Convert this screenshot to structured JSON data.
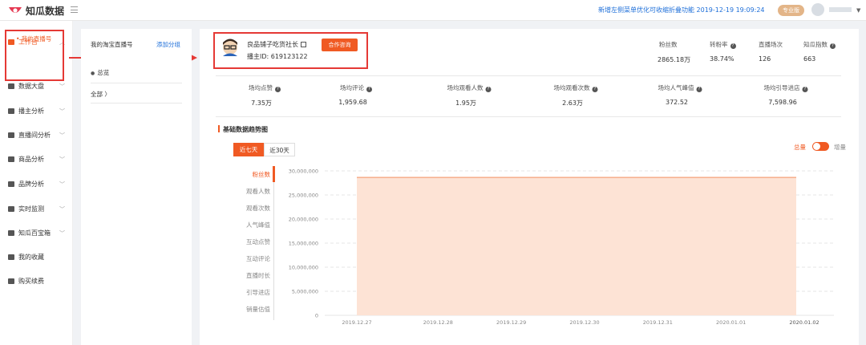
{
  "app": {
    "name": "知瓜数据"
  },
  "header": {
    "notice": "新增左侧菜单优化可收缩折叠功能  2019-12-19 19:09:24",
    "badge": "专业版"
  },
  "sidebar": {
    "items": [
      {
        "label": "工作台",
        "icon": "workspace-icon",
        "active": true
      },
      {
        "label": "数据大盘",
        "icon": "dashboard-icon"
      },
      {
        "label": "播主分析",
        "icon": "anchor-analysis-icon"
      },
      {
        "label": "直播间分析",
        "icon": "live-room-icon"
      },
      {
        "label": "商品分析",
        "icon": "product-icon"
      },
      {
        "label": "品牌分析",
        "icon": "brand-icon"
      },
      {
        "label": "实时监测",
        "icon": "monitor-icon"
      },
      {
        "label": "知瓜百宝箱",
        "icon": "toolbox-icon"
      },
      {
        "label": "我的收藏",
        "icon": "bookmark-icon"
      },
      {
        "label": "购买续费",
        "icon": "cart-icon"
      }
    ],
    "sub_item": "• 我的直播号"
  },
  "panel": {
    "title": "我的淘宝直播号",
    "add_group": "添加分组",
    "overview": "总览",
    "all": "全部  〉"
  },
  "anchor": {
    "name": "良品铺子吃货社长",
    "id": "播主ID: 619123122",
    "consult_button": "合作咨询"
  },
  "header_stats": [
    {
      "label": "粉丝数",
      "value": "2865.18万",
      "help": false
    },
    {
      "label": "转粉率",
      "value": "38.74%",
      "help": true
    },
    {
      "label": "直播场次",
      "value": "126",
      "help": false
    },
    {
      "label": "知瓜指数",
      "value": "663",
      "help": true
    }
  ],
  "stats": [
    {
      "label": "场均点赞",
      "value": "7.35万"
    },
    {
      "label": "场均评论",
      "value": "1,959.68"
    },
    {
      "label": "场均观看人数",
      "value": "1.95万"
    },
    {
      "label": "场均观看次数",
      "value": "2.63万"
    },
    {
      "label": "场均人气峰值",
      "value": "372.52"
    },
    {
      "label": "场均引导进店",
      "value": "7,598.96"
    }
  ],
  "trend": {
    "title": "基础数据趋势图",
    "range_tabs": [
      "近七天",
      "近30天"
    ],
    "toggle_left": "总量",
    "toggle_right": "增量",
    "metrics": [
      "粉丝数",
      "观看人数",
      "观看次数",
      "人气峰值",
      "互动点赞",
      "互动评论",
      "直播时长",
      "引导进店",
      "销量估值"
    ]
  },
  "chart_data": {
    "type": "area",
    "x": [
      "2019.12.27",
      "2019.12.28",
      "2019.12.29",
      "2019.12.30",
      "2019.12.31",
      "2020.01.01",
      "2020.01.02"
    ],
    "series": [
      {
        "values": [
          28651800,
          28651800,
          28651800,
          28651800,
          28651800,
          28651800,
          28651800
        ]
      }
    ],
    "yticks": [
      "30,000,000",
      "25,000,000",
      "20,000,000",
      "15,000,000",
      "10,000,000",
      "5,000,000",
      "0"
    ],
    "ylim": [
      0,
      30000000
    ],
    "grid": true,
    "color": "#f05a23"
  }
}
